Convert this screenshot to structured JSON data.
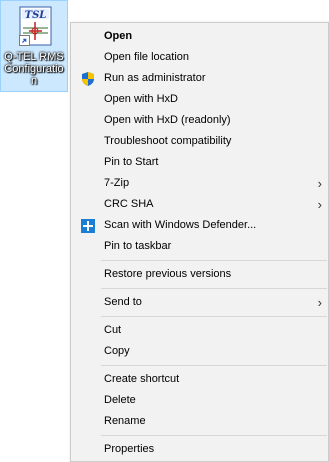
{
  "desktop_icon": {
    "label": "Q-TEL RMS Configuratio n",
    "logo_text": "TSL"
  },
  "menu": {
    "sections": [
      [
        {
          "label": "Open",
          "default": true
        },
        {
          "label": "Open file location"
        },
        {
          "label": "Run as administrator",
          "icon": "uac-shield-icon"
        },
        {
          "label": "Open with HxD"
        },
        {
          "label": "Open with HxD (readonly)"
        },
        {
          "label": "Troubleshoot compatibility"
        },
        {
          "label": "Pin to Start"
        },
        {
          "label": "7-Zip",
          "submenu": true
        },
        {
          "label": "CRC SHA",
          "submenu": true
        },
        {
          "label": "Scan with Windows Defender...",
          "icon": "windows-defender-icon"
        },
        {
          "label": "Pin to taskbar"
        }
      ],
      [
        {
          "label": "Restore previous versions"
        }
      ],
      [
        {
          "label": "Send to",
          "submenu": true
        }
      ],
      [
        {
          "label": "Cut"
        },
        {
          "label": "Copy"
        }
      ],
      [
        {
          "label": "Create shortcut"
        },
        {
          "label": "Delete"
        },
        {
          "label": "Rename"
        }
      ],
      [
        {
          "label": "Properties"
        }
      ]
    ]
  },
  "colors": {
    "selection_bg": "#cce8ff",
    "menu_bg": "#f2f2f2",
    "shield_blue": "#1f6fd1",
    "shield_yellow": "#f5c400",
    "defender_blue": "#1a7fd4"
  }
}
